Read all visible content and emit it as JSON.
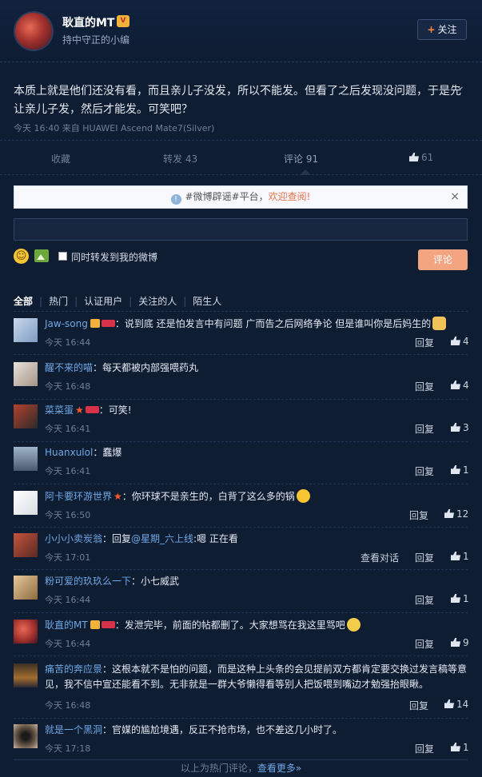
{
  "post": {
    "author": "耿直的MT",
    "subtitle": "持中守正的小编",
    "follow_label": "关注",
    "text": "本质上就是他们还没有看，而且亲儿子没发，所以不能发。但看了之后发现没问题，于是先让亲儿子发，然后才能发。可笑吧？",
    "meta": "今天 16:40 来自 HUAWEI Ascend Mate7(Silver)"
  },
  "actions": {
    "collect": "收藏",
    "forward": "转发 43",
    "comment": "评论 91",
    "like": "61"
  },
  "notice": {
    "text": "#微博辟谣#平台，",
    "link": "欢迎查阅!"
  },
  "composer": {
    "checkbox_label": "同时转发到我的微博",
    "submit_label": "评论"
  },
  "filters": [
    "全部",
    "热门",
    "认证用户",
    "关注的人",
    "陌生人"
  ],
  "comments": [
    {
      "user": "Jaw-song",
      "text": "：说到底 还是怕发言中有问题 广而告之后网络争论 但是谁叫你是后妈生的",
      "time": "今天 16:44",
      "reply": "回复",
      "likes": "4"
    },
    {
      "user": "醒不来的喵",
      "text": "：每天都被内部强喂药丸",
      "time": "今天 16:48",
      "reply": "回复",
      "likes": "4"
    },
    {
      "user": "菜菜蛋",
      "text": "：可笑!",
      "time": "今天 16:41",
      "reply": "回复",
      "likes": "3"
    },
    {
      "user": "Huanxulol",
      "text": "：蠢爆",
      "time": "今天 16:41",
      "reply": "回复",
      "likes": "1"
    },
    {
      "user": "阿卡要环游世界",
      "text": "：你环球不是亲生的，白背了这么多的锅",
      "time": "今天 16:50",
      "reply": "回复",
      "likes": "12"
    },
    {
      "user": "小小小卖炭翁",
      "text_prefix": "：回复",
      "mention": "@星期_六上线",
      "text": ":嗯 正在看",
      "time": "今天 17:01",
      "view": "查看对话",
      "reply": "回复",
      "likes": "1"
    },
    {
      "user": "粉可爱的玖玖么一下",
      "text": "：小七威武",
      "time": "今天 16:44",
      "reply": "回复",
      "likes": "1"
    },
    {
      "user": "耿直的MT",
      "text": "：发泄完毕，前面的帖都删了。大家想骂在我这里骂吧",
      "time": "今天 16:44",
      "reply": "回复",
      "likes": "9"
    },
    {
      "user": "痛苦的奔应景",
      "text": "：这根本就不是怕的问题，而是这种上头条的会见提前双方都肯定要交换过发言稿等意见，我不信中宣还能看不到。无非就是一群大爷懒得看等别人把饭喂到嘴边才勉强抬眼瞅。",
      "time": "今天 16:48",
      "reply": "回复",
      "likes": "14"
    },
    {
      "user": "就是一个黑洞",
      "text": "：官媒的尴尬境遇，反正不抢市场，也不差这几小时了。",
      "time": "今天 17:18",
      "reply": "回复",
      "likes": "1"
    }
  ],
  "footer": {
    "text": "以上为热门评论，",
    "more": "查看更多»"
  },
  "colors": {
    "background": "#0f1d33",
    "link": "#6fa8e6",
    "accent": "#f3a582"
  }
}
